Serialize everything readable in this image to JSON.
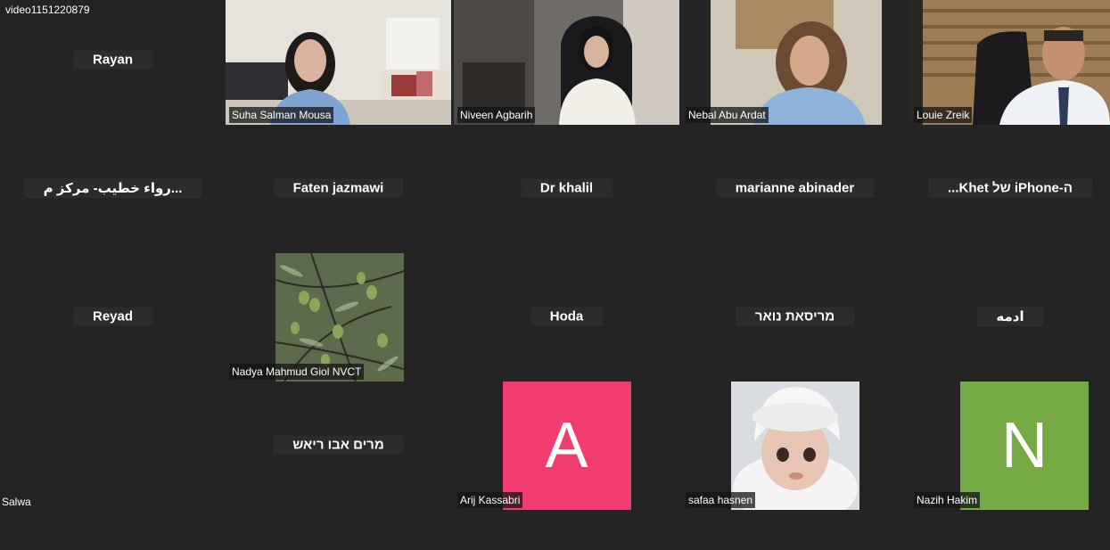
{
  "window": {
    "title": "video1151220879"
  },
  "participants": [
    {
      "id": "rayan",
      "label": "Rayan",
      "type": "name"
    },
    {
      "id": "suha",
      "label": "Suha Salman Mousa",
      "type": "video"
    },
    {
      "id": "niveen",
      "label": "Niveen Agbarih",
      "type": "video"
    },
    {
      "id": "nebal",
      "label": "Nebal Abu Ardat",
      "type": "video"
    },
    {
      "id": "louie",
      "label": "Louie Zreik",
      "type": "video"
    },
    {
      "id": "rawaa",
      "label": "...رواء خطيب- مركز م",
      "type": "name"
    },
    {
      "id": "faten",
      "label": "Faten jazmawi",
      "type": "name"
    },
    {
      "id": "drkhalil",
      "label": "Dr khalil",
      "type": "name"
    },
    {
      "id": "marianne",
      "label": "marianne abinader",
      "type": "name"
    },
    {
      "id": "khet",
      "label": "ה-iPhone של Khet...",
      "type": "name"
    },
    {
      "id": "reyad",
      "label": "Reyad",
      "type": "name"
    },
    {
      "id": "nadya",
      "label": "Nadya Mahmud Giol NVCT",
      "type": "image"
    },
    {
      "id": "hoda",
      "label": "Hoda",
      "type": "name"
    },
    {
      "id": "marisat",
      "label": "מריסאת נואר",
      "type": "name"
    },
    {
      "id": "adama",
      "label": "ادمه",
      "type": "name"
    },
    {
      "id": "salwa",
      "label": "Salwa",
      "type": "caption-only"
    },
    {
      "id": "marim",
      "label": "מרים אבו ריאש",
      "type": "name"
    },
    {
      "id": "arij",
      "label": "Arij Kassabri",
      "type": "avatar",
      "letter": "A",
      "color": "#f03c6e"
    },
    {
      "id": "safaa",
      "label": "safaa hasnen",
      "type": "image"
    },
    {
      "id": "nazih",
      "label": "Nazih Hakim",
      "type": "avatar",
      "letter": "N",
      "color": "#74a943"
    }
  ]
}
